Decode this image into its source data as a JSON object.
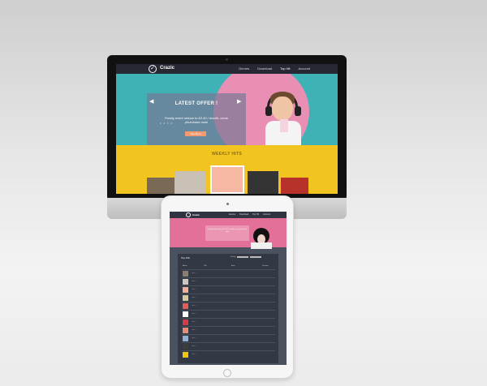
{
  "desktop": {
    "brand": "Crazic",
    "nav": [
      "Genres",
      "Download",
      "Top Hit",
      "Account"
    ],
    "offer": {
      "title": "LATEST OFFER !",
      "text": "Family event reduce to £2.40 / month, come phurchase now!",
      "button": "See More"
    },
    "weekly_title": "WEEKLY HITS"
  },
  "tablet": {
    "brand": "Crazic",
    "nav": [
      "Genres",
      "Download",
      "Top Hit",
      "Account"
    ],
    "offer_text": "Family event reduce to £2.40 / month, come phurchase now!",
    "table": {
      "title": "Top 100",
      "sort_label": "Sort by",
      "columns": [
        "Album",
        "Title",
        "Artist",
        "Duration"
      ]
    }
  }
}
